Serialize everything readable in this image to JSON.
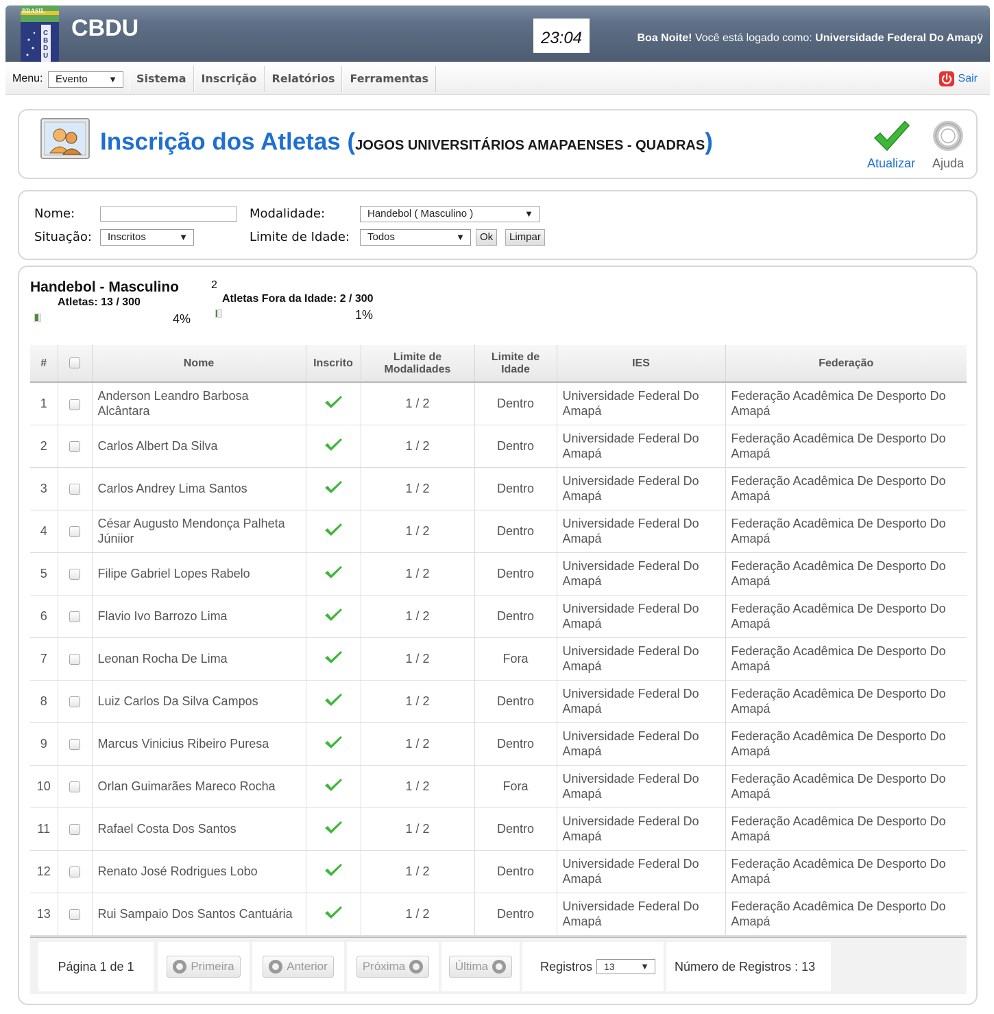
{
  "header": {
    "app_title": "CBDU",
    "logo_country": "BRASIL",
    "logo_letters": "CBDU",
    "clock": "23:04",
    "greeting_strong": "Boa Noite!",
    "greeting_text": " Você está logado como: ",
    "user_name": "Universidade Federal Do Amapÿ"
  },
  "menu": {
    "label": "Menu:",
    "selected": "Evento",
    "items": [
      "Sistema",
      "Inscrição",
      "Relatórios",
      "Ferramentas"
    ],
    "logout": "Sair"
  },
  "page": {
    "title": "Inscrição dos Atletas ",
    "paren_open": "(",
    "subtitle": "JOGOS UNIVERSITÁRIOS AMAPAENSES - QUADRAS",
    "paren_close": ")",
    "refresh_label": "Atualizar",
    "help_label": "Ajuda"
  },
  "filters": {
    "nome_label": "Nome:",
    "nome_value": "",
    "modalidade_label": "Modalidade:",
    "modalidade_value": "Handebol ( Masculino )",
    "situacao_label": "Situação:",
    "situacao_value": "Inscritos",
    "idade_label": "Limite de Idade:",
    "idade_value": "Todos",
    "ok_label": "Ok",
    "clear_label": "Limpar"
  },
  "stats": {
    "title": "Handebol - Masculino",
    "badge": "2",
    "atletas": "Atletas: 13 / 300",
    "atletas_pct": "4%",
    "atletas_fraction": 0.04,
    "fora": "Atletas Fora da Idade: 2 / 300",
    "fora_pct": "1%",
    "fora_fraction": 0.01
  },
  "table": {
    "headers": [
      "#",
      "",
      "Nome",
      "Inscrito",
      "Limite de Modalidades",
      "Limite de Idade",
      "IES",
      "Federação"
    ],
    "rows": [
      {
        "n": "1",
        "nome": "Anderson Leandro Barbosa Alcântara",
        "mod": "1 / 2",
        "idade": "Dentro",
        "ies": "Universidade Federal Do Amapá",
        "fed": "Federação Acadêmica De Desporto Do Amapá"
      },
      {
        "n": "2",
        "nome": "Carlos Albert Da Silva",
        "mod": "1 / 2",
        "idade": "Dentro",
        "ies": "Universidade Federal Do Amapá",
        "fed": "Federação Acadêmica De Desporto Do Amapá"
      },
      {
        "n": "3",
        "nome": "Carlos Andrey Lima Santos",
        "mod": "1 / 2",
        "idade": "Dentro",
        "ies": "Universidade Federal Do Amapá",
        "fed": "Federação Acadêmica De Desporto Do Amapá"
      },
      {
        "n": "4",
        "nome": "César Augusto Mendonça Palheta Júniior",
        "mod": "1 / 2",
        "idade": "Dentro",
        "ies": "Universidade Federal Do Amapá",
        "fed": "Federação Acadêmica De Desporto Do Amapá"
      },
      {
        "n": "5",
        "nome": "Filipe Gabriel Lopes Rabelo",
        "mod": "1 / 2",
        "idade": "Dentro",
        "ies": "Universidade Federal Do Amapá",
        "fed": "Federação Acadêmica De Desporto Do Amapá"
      },
      {
        "n": "6",
        "nome": "Flavio Ivo Barrozo Lima",
        "mod": "1 / 2",
        "idade": "Dentro",
        "ies": "Universidade Federal Do Amapá",
        "fed": "Federação Acadêmica De Desporto Do Amapá"
      },
      {
        "n": "7",
        "nome": "Leonan Rocha De Lima",
        "mod": "1 / 2",
        "idade": "Fora",
        "ies": "Universidade Federal Do Amapá",
        "fed": "Federação Acadêmica De Desporto Do Amapá"
      },
      {
        "n": "8",
        "nome": "Luiz Carlos Da Silva Campos",
        "mod": "1 / 2",
        "idade": "Dentro",
        "ies": "Universidade Federal Do Amapá",
        "fed": "Federação Acadêmica De Desporto Do Amapá"
      },
      {
        "n": "9",
        "nome": "Marcus Vinicius Ribeiro Puresa",
        "mod": "1 / 2",
        "idade": "Dentro",
        "ies": "Universidade Federal Do Amapá",
        "fed": "Federação Acadêmica De Desporto Do Amapá"
      },
      {
        "n": "10",
        "nome": "Orlan Guimarães Mareco Rocha",
        "mod": "1 / 2",
        "idade": "Fora",
        "ies": "Universidade Federal Do Amapá",
        "fed": "Federação Acadêmica De Desporto Do Amapá"
      },
      {
        "n": "11",
        "nome": "Rafael Costa Dos Santos",
        "mod": "1 / 2",
        "idade": "Dentro",
        "ies": "Universidade Federal Do Amapá",
        "fed": "Federação Acadêmica De Desporto Do Amapá"
      },
      {
        "n": "12",
        "nome": "Renato José Rodrigues Lobo",
        "mod": "1 / 2",
        "idade": "Dentro",
        "ies": "Universidade Federal Do Amapá",
        "fed": "Federação Acadêmica De Desporto Do Amapá"
      },
      {
        "n": "13",
        "nome": "Rui Sampaio Dos Santos Cantuária",
        "mod": "1 / 2",
        "idade": "Dentro",
        "ies": "Universidade Federal Do Amapá",
        "fed": "Federação Acadêmica De Desporto Do Amapá"
      }
    ]
  },
  "pager": {
    "page_info": "Página 1 de 1",
    "first": "Primeira",
    "prev": "Anterior",
    "next": "Próxima",
    "last": "Última",
    "records_label": "Registros",
    "records_value": "13",
    "total": "Número de Registros : 13"
  },
  "colors": {
    "brand_blue": "#1e6fd1",
    "header_bg": "#5f7088",
    "check_green": "#3db83a",
    "logout_red": "#e53232"
  },
  "icons": {
    "logout": "power-icon",
    "refresh": "checkmark-icon",
    "help": "lifebuoy-icon",
    "title": "users-icon",
    "inscrito": "checkmark-icon"
  }
}
